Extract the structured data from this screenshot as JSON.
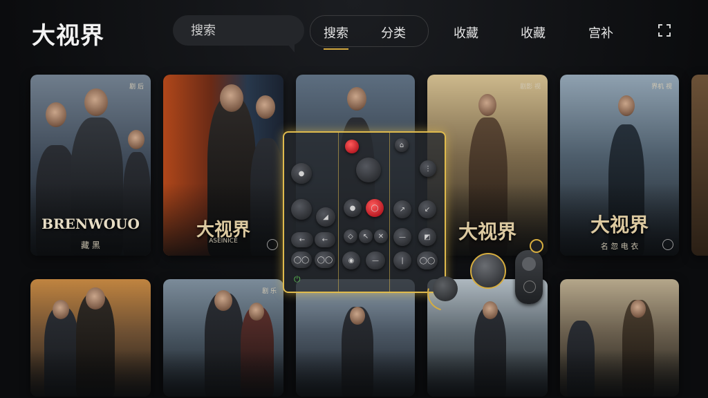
{
  "header": {
    "logo": "大视界",
    "search_placeholder": "搜索",
    "tabs": [
      {
        "label": "搜索",
        "active": true
      },
      {
        "label": "分类",
        "active": false
      },
      {
        "label": "收藏",
        "active": false
      },
      {
        "label": "收藏",
        "active": false
      },
      {
        "label": "宫补",
        "active": false
      }
    ]
  },
  "posters": [
    {
      "title": "BRENWOUO",
      "sub": "藏 黑",
      "tag": "剧 后"
    },
    {
      "title": "大视界",
      "sub": "ASEINICE",
      "tag": ""
    },
    {
      "title": "",
      "sub": "",
      "tag": ""
    },
    {
      "title": "大视界",
      "sub": "",
      "tag": "剧影 视"
    },
    {
      "title": "大视界",
      "sub": "名 忽 电 衣",
      "tag": "界机 视"
    },
    {
      "title": "",
      "sub": "",
      "tag": ""
    },
    {
      "title": "",
      "sub": "",
      "tag": "剧 乐"
    },
    {
      "title": "",
      "sub": "",
      "tag": ""
    },
    {
      "title": "",
      "sub": "",
      "tag": ""
    },
    {
      "title": "",
      "sub": "",
      "tag": ""
    }
  ],
  "colors": {
    "accent": "#d4a93e",
    "background": "#0c0d0f"
  }
}
